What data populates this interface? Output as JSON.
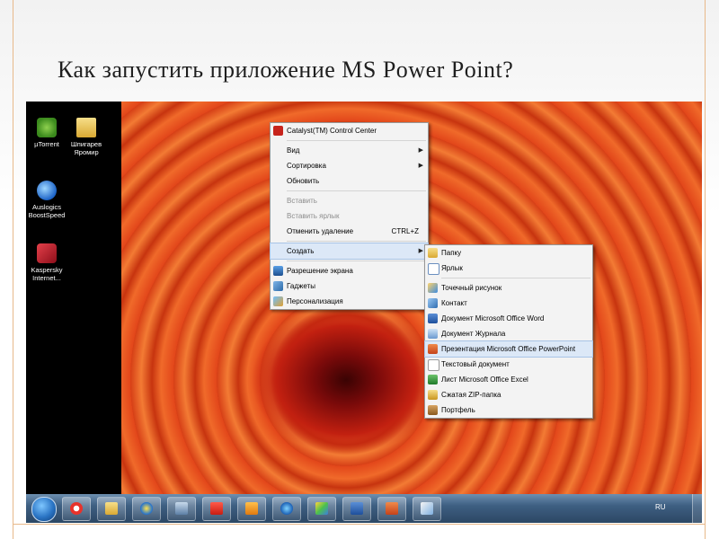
{
  "slide": {
    "bullet": "",
    "title": "Как запустить приложение MS Power Point?"
  },
  "desktop_icons": [
    {
      "label": "µTorrent",
      "icon": "utorrent-icon"
    },
    {
      "label": "Шпигарев Яромир",
      "icon": "folder-icon"
    },
    {
      "label": "Auslogics BoostSpeed",
      "icon": "boostspeed-icon"
    },
    {
      "label": "Kaspersky Internet...",
      "icon": "kaspersky-icon"
    }
  ],
  "context_menu": {
    "items": [
      {
        "label": "Catalyst(TM) Control Center",
        "icon": "catalyst-icon"
      },
      {
        "label": "Вид"
      },
      {
        "label": "Сортировка"
      },
      {
        "label": "Обновить"
      },
      {
        "label": "Вставить"
      },
      {
        "label": "Вставить ярлык"
      },
      {
        "label": "Отменить удаление",
        "shortcut": "CTRL+Z"
      },
      {
        "label": "Создать"
      },
      {
        "label": "Разрешение экрана",
        "icon": "display-icon"
      },
      {
        "label": "Гаджеты",
        "icon": "gadgets-icon"
      },
      {
        "label": "Персонализация",
        "icon": "personalize-icon"
      }
    ]
  },
  "submenu": {
    "items": [
      {
        "label": "Папку",
        "icon": "folder-icon"
      },
      {
        "label": "Ярлык",
        "icon": "shortcut-icon"
      },
      {
        "label": "Точечный рисунок",
        "icon": "bitmap-icon"
      },
      {
        "label": "Контакт",
        "icon": "contact-icon"
      },
      {
        "label": "Документ Microsoft Office Word",
        "icon": "word-icon"
      },
      {
        "label": "Документ Журнала",
        "icon": "journal-icon"
      },
      {
        "label": "Презентация Microsoft Office PowerPoint",
        "icon": "powerpoint-icon"
      },
      {
        "label": "Текстовый документ",
        "icon": "text-icon"
      },
      {
        "label": "Лист Microsoft Office Excel",
        "icon": "excel-icon"
      },
      {
        "label": "Сжатая ZIP-папка",
        "icon": "zip-icon"
      },
      {
        "label": "Портфель",
        "icon": "briefcase-icon"
      }
    ]
  },
  "taskbar": {
    "language": "RU",
    "buttons": [
      "yandex-browser-icon",
      "explorer-icon",
      "shield-icon",
      "volume-icon",
      "yandex-icon",
      "media-icon",
      "browser-icon",
      "colorful-icon",
      "word-icon",
      "powerpoint-icon",
      "paint-icon"
    ]
  },
  "colors": {
    "accent_border": "#e8b98a",
    "menu_highlight": "#dce8f7",
    "taskbar": "#3e5f82"
  }
}
